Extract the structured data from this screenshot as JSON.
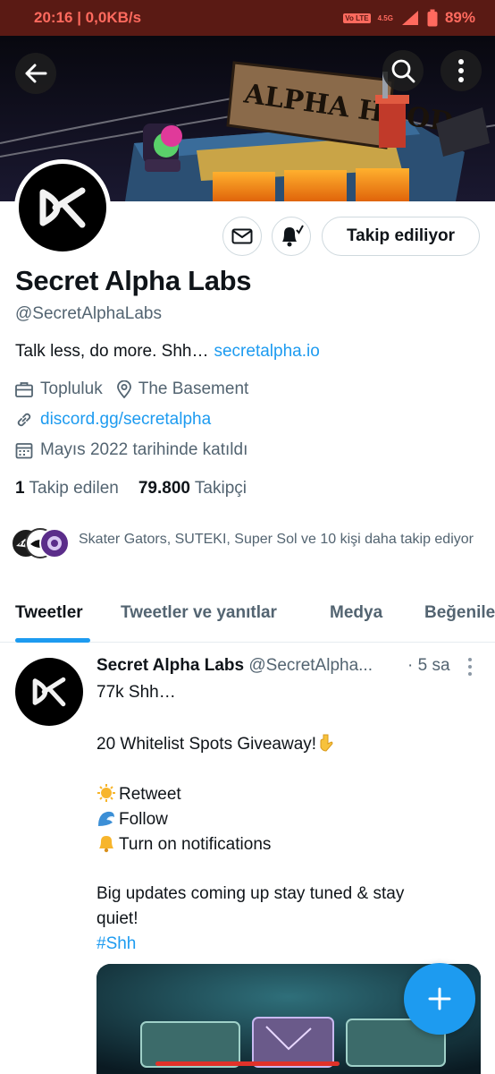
{
  "status_bar": {
    "time_speed": "20:16 | 0,0KB/s",
    "volte": "Vo LTE",
    "network": "4.5G",
    "battery": "89%"
  },
  "banner": {
    "sign_text": "ALPHA HOOD"
  },
  "profile": {
    "name": "Secret Alpha Labs",
    "handle": "@SecretAlphaLabs",
    "bio": "Talk less, do more. Shh…",
    "bio_link": "secretalpha.io",
    "category": "Topluluk",
    "location": "The Basement",
    "website": "discord.gg/secretalpha",
    "joined": "Mayıs 2022 tarihinde katıldı",
    "following_count": "1",
    "following_label": "Takip edilen",
    "followers_count": "79.800",
    "followers_label": "Takipçi",
    "follow_button_label": "Takip ediliyor",
    "followed_by": "Skater Gators, SUTEKI, Super Sol ve 10 kişi daha takip ediyor"
  },
  "tabs": [
    {
      "label": "Tweetler",
      "active": true
    },
    {
      "label": "Tweetler ve yanıtlar",
      "active": false
    },
    {
      "label": "Medya",
      "active": false
    },
    {
      "label": "Beğeniler",
      "active": false
    }
  ],
  "tweet": {
    "author_name": "Secret Alpha Labs",
    "author_handle": "@SecretAlpha...",
    "time": "· 5 sa",
    "lines": [
      "77k Shh…",
      "20 Whitelist Spots Giveaway!",
      "Retweet",
      "Follow",
      "Turn on notifications",
      "Big updates coming up stay tuned & stay",
      "quiet!",
      "#Shh"
    ]
  },
  "colors": {
    "accent": "#1d9bf0",
    "status_bar_bg": "#5a1a14",
    "status_text": "#ff6a5e",
    "muted_text": "#536471"
  },
  "icons": {
    "back": "arrow-left-icon",
    "search": "search-icon",
    "more": "more-vertical-icon",
    "message": "envelope-icon",
    "notify": "bell-icon",
    "category": "briefcase-icon",
    "location": "location-pin-icon",
    "link": "link-icon",
    "calendar": "calendar-icon",
    "compose": "plus-icon"
  }
}
